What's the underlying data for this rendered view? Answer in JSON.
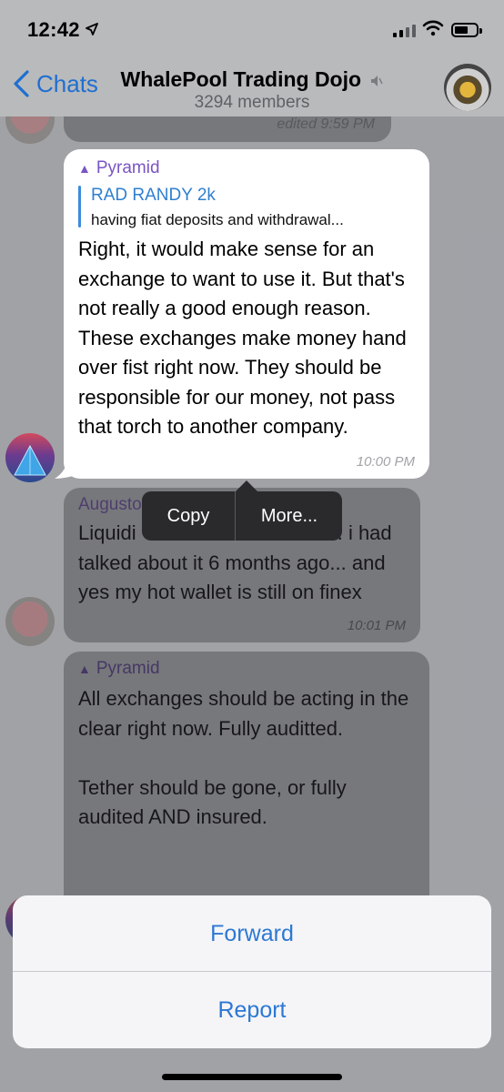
{
  "status_bar": {
    "time": "12:42"
  },
  "nav": {
    "back_label": "Chats",
    "title": "WhalePool Trading Dojo",
    "subtitle": "3294 members"
  },
  "messages": {
    "edited": {
      "label": "edited 9:59 PM"
    },
    "main": {
      "sender": "Pyramid",
      "reply_name": "RAD RANDY 2k",
      "reply_text": "having fiat deposits and withdrawal...",
      "text": "Right, it would make sense for an exchange to want to use it. But that's not really a good enough reason. These exchanges make money hand over fist right now. They should be responsible for our money, not pass that torch to another company.",
      "time": "10:00 PM"
    },
    "august": {
      "sender": "Augusto",
      "line1_start": "Liquidi",
      "line1_end": ".. i had",
      "text_rest": "talked about it 6 months ago... and yes my hot wallet is still on finex",
      "time": "10:01 PM"
    },
    "pyramid2": {
      "sender": "Pyramid",
      "text": "All exchanges should be acting in the clear right now. Fully auditted.\n\nTether should be gone, or fully audited AND insured."
    }
  },
  "context_menu": {
    "copy": "Copy",
    "more": "More..."
  },
  "action_sheet": {
    "forward": "Forward",
    "report": "Report"
  },
  "colors": {
    "accent": "#2c78d3",
    "sender_purple": "#7a55c5",
    "reply_blue": "#2f7fcf"
  },
  "icons": [
    "location-arrow-icon",
    "signal-icon",
    "wifi-icon",
    "battery-icon",
    "chevron-left-icon",
    "mute-icon"
  ]
}
